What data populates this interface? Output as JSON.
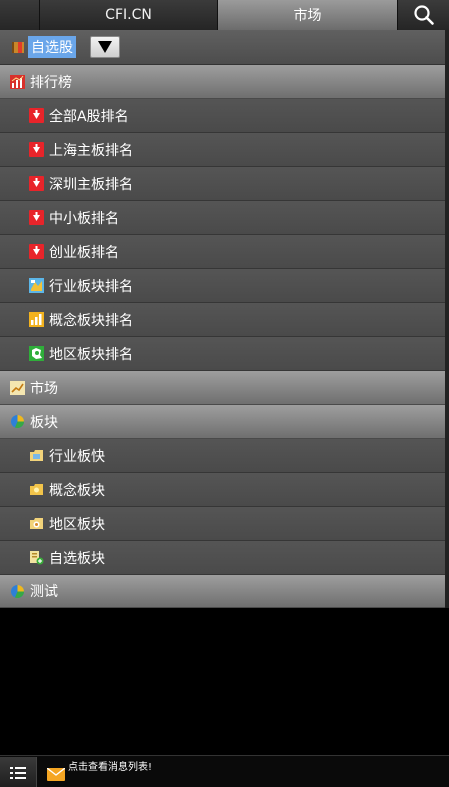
{
  "topbar": {
    "tabs": [
      {
        "label": "CFI.CN"
      },
      {
        "label": "市场"
      }
    ]
  },
  "self_select": {
    "label": "自选股"
  },
  "ranking": {
    "header": "排行榜",
    "items": [
      {
        "label": "全部A股排名",
        "icon": "red-down-arrow-icon"
      },
      {
        "label": "上海主板排名",
        "icon": "red-down-arrow-icon"
      },
      {
        "label": "深圳主板排名",
        "icon": "red-down-arrow-icon"
      },
      {
        "label": "中小板排名",
        "icon": "red-down-arrow-icon"
      },
      {
        "label": "创业板排名",
        "icon": "red-down-arrow-icon"
      },
      {
        "label": "行业板块排名",
        "icon": "industry-map-icon"
      },
      {
        "label": "概念板块排名",
        "icon": "bar-chart-icon"
      },
      {
        "label": "地区板块排名",
        "icon": "region-map-icon"
      }
    ]
  },
  "market": {
    "header": "市场"
  },
  "sectors": {
    "header": "板块",
    "items": [
      {
        "label": "行业板快",
        "icon": "folder-industry-icon"
      },
      {
        "label": "概念板块",
        "icon": "folder-concept-icon"
      },
      {
        "label": "地区板块",
        "icon": "folder-region-icon"
      },
      {
        "label": "自选板块",
        "icon": "custom-sector-icon"
      }
    ]
  },
  "test": {
    "header": "测试"
  },
  "bottombar": {
    "message": "点击查看消息列表!"
  },
  "colors": {
    "header_bg": "#8a8a8a",
    "item_bg": "#4f4f4f",
    "highlight": "#6aa6ea",
    "arrow_red": "#e8242a"
  }
}
